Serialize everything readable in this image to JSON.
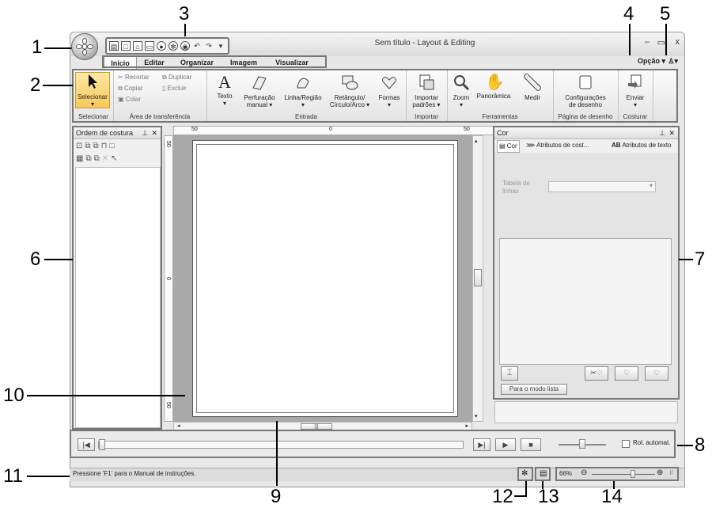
{
  "callouts": [
    "1",
    "2",
    "3",
    "4",
    "5",
    "6",
    "7",
    "8",
    "9",
    "10",
    "11",
    "12",
    "13",
    "14"
  ],
  "window": {
    "title": "Sem título - Layout & Editing",
    "minimize": "–",
    "maximize": "▭",
    "close": "x"
  },
  "tabs": [
    "Início",
    "Editar",
    "Organizar",
    "Imagem",
    "Visualizar"
  ],
  "menu": {
    "option": "Opção",
    "option_arrow": "▾",
    "help": "▾"
  },
  "ribbon": {
    "select": {
      "label": "Selecionar",
      "arrow": "▾",
      "group": "Selecionar"
    },
    "clipboard": {
      "cut": "Recortar",
      "duplicate": "Duplicar",
      "copy": "Copiar",
      "delete": "Excluir",
      "paste": "Colar",
      "group": "Área de transferência"
    },
    "input": {
      "text": "Texto",
      "text_arrow": "▾",
      "punch_1": "Perfuração",
      "punch_2": "manual ▾",
      "line": "Linha/Região",
      "line_arrow": "▾",
      "rect_1": "Retângulo/",
      "rect_2": "Círculo/Arco ▾",
      "shapes": "Formas",
      "shapes_arrow": "▾",
      "group": "Entrada"
    },
    "import": {
      "label_1": "Importar",
      "label_2": "padrões ▾",
      "group": "Importar"
    },
    "tools": {
      "zoom": "Zoom",
      "zoom_arrow": "▾",
      "pan": "Panorâmica",
      "measure": "Medir",
      "group": "Ferramentas"
    },
    "page": {
      "label_1": "Configurações",
      "label_2": "de desenho",
      "group": "Página de desenho"
    },
    "sew": {
      "label": "Enviar",
      "arrow": "▾",
      "group": "Costurar"
    }
  },
  "sew_order_panel": {
    "title": "Ordem de costura",
    "pin": "⊥",
    "close": "✕"
  },
  "color_panel": {
    "title": "Cor",
    "pin": "⊥",
    "close": "✕",
    "tab_color": "Cor",
    "tab_sew_attr": "Atributos de cost...",
    "tab_text_attr_prefix": "AB",
    "tab_text_attr": "Atributos de texto",
    "table_label_1": "Tabela de",
    "table_label_2": "linhas",
    "list_mode_button": "Para o modo lista"
  },
  "rulers": {
    "top": [
      "50",
      "0",
      "50"
    ],
    "left": [
      "50",
      "0",
      "50"
    ]
  },
  "scroll_grip": "|||",
  "playback": {
    "auto_scroll": "Rol. automat."
  },
  "status": {
    "message": "Pressione 'F1' para o Manual de instruções.",
    "zoom": "66%",
    "zoom_level_percent": 66
  }
}
